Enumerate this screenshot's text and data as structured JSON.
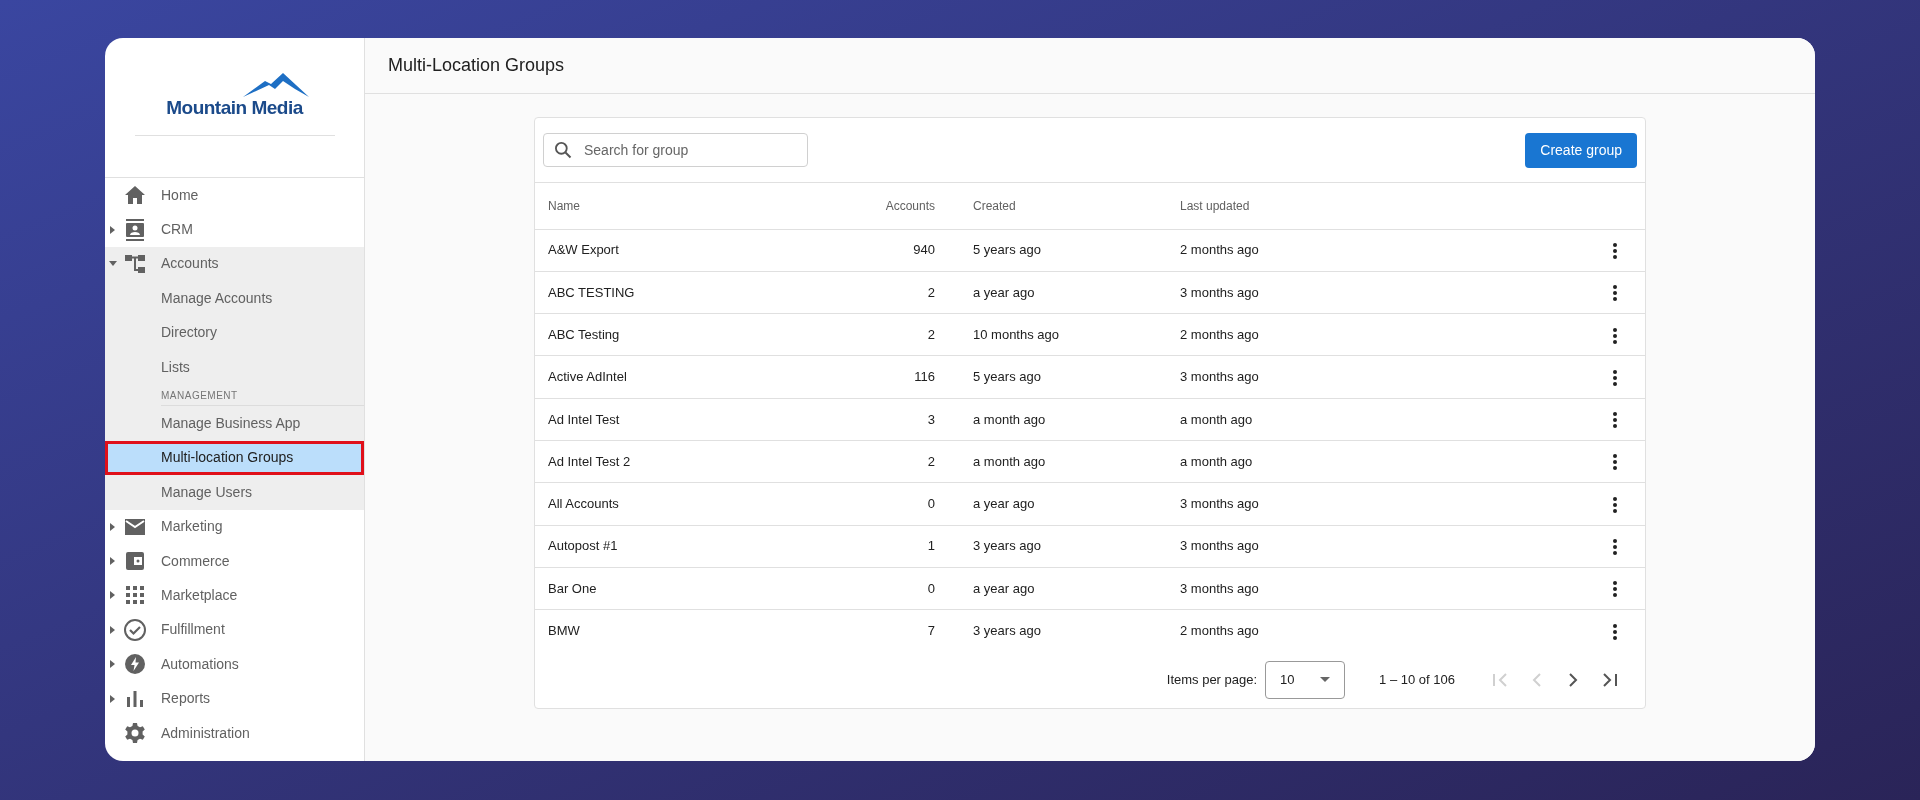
{
  "logo": {
    "text": "Mountain Media"
  },
  "sidebar": {
    "items": [
      {
        "label": "Home"
      },
      {
        "label": "CRM",
        "expanded": false
      },
      {
        "label": "Accounts",
        "expanded": true,
        "children": [
          {
            "kind": "sub",
            "label": "Manage Accounts",
            "selected": false
          },
          {
            "kind": "sub",
            "label": "Directory",
            "selected": false
          },
          {
            "kind": "sub",
            "label": "Lists",
            "selected": false
          },
          {
            "kind": "section",
            "label": "MANAGEMENT"
          },
          {
            "kind": "sub",
            "label": "Manage Business App",
            "selected": false
          },
          {
            "kind": "sub",
            "label": "Multi-location Groups",
            "selected": true
          },
          {
            "kind": "sub",
            "label": "Manage Users",
            "selected": false
          }
        ]
      },
      {
        "label": "Marketing",
        "expanded": false
      },
      {
        "label": "Commerce",
        "expanded": false
      },
      {
        "label": "Marketplace",
        "expanded": false
      },
      {
        "label": "Fulfillment",
        "expanded": false
      },
      {
        "label": "Automations",
        "expanded": false
      },
      {
        "label": "Reports",
        "expanded": false
      },
      {
        "label": "Administration"
      }
    ]
  },
  "header": {
    "title": "Multi-Location Groups"
  },
  "search": {
    "placeholder": "Search for group"
  },
  "create_button": "Create group",
  "table": {
    "columns": [
      "Name",
      "Accounts",
      "Created",
      "Last updated"
    ],
    "rows": [
      [
        "A&W Export",
        "940",
        "5 years ago",
        "2 months ago"
      ],
      [
        "ABC TESTING",
        "2",
        "a year ago",
        "3 months ago"
      ],
      [
        "ABC Testing",
        "2",
        "10 months ago",
        "2 months ago"
      ],
      [
        "Active AdIntel",
        "116",
        "5 years ago",
        "3 months ago"
      ],
      [
        "Ad Intel Test",
        "3",
        "a month ago",
        "a month ago"
      ],
      [
        "Ad Intel Test 2",
        "2",
        "a month ago",
        "a month ago"
      ],
      [
        "All Accounts",
        "0",
        "a year ago",
        "3 months ago"
      ],
      [
        "Autopost #1",
        "1",
        "3 years ago",
        "3 months ago"
      ],
      [
        "Bar One",
        "0",
        "a year ago",
        "3 months ago"
      ],
      [
        "BMW",
        "7",
        "3 years ago",
        "2 months ago"
      ]
    ]
  },
  "pagination": {
    "items_label": "Items per page:",
    "page_size": "10",
    "range": "1 – 10 of 106",
    "buttons": [
      {
        "kind": "first",
        "disabled": true
      },
      {
        "kind": "prev",
        "disabled": true
      },
      {
        "kind": "next",
        "disabled": false
      },
      {
        "kind": "last",
        "disabled": false
      }
    ]
  }
}
